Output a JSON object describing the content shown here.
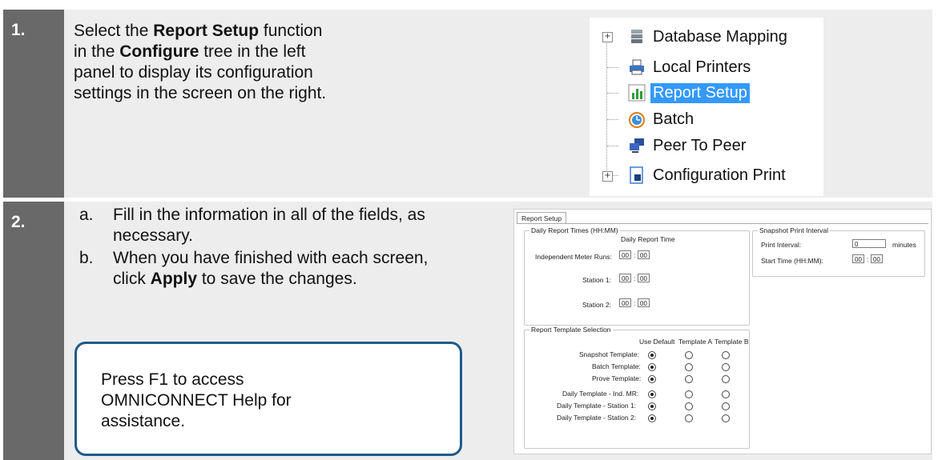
{
  "step1": {
    "number": "1.",
    "text_a": "Select the ",
    "text_b": "Report Setup",
    "text_c": " function in the ",
    "text_d": "Configure",
    "text_e": " tree in the left panel to display its configuration settings in the screen on the right.",
    "tree": [
      {
        "label": "Database Mapping",
        "icon": "database-icon",
        "expander": "+"
      },
      {
        "label": "Local Printers",
        "icon": "printer-icon"
      },
      {
        "label": "Report Setup",
        "icon": "report-chart-icon",
        "selected": true
      },
      {
        "label": "Batch",
        "icon": "clock-icon"
      },
      {
        "label": "Peer To Peer",
        "icon": "computers-icon"
      },
      {
        "label": "Configuration Print",
        "icon": "page-icon",
        "expander": "+"
      }
    ]
  },
  "step2": {
    "number": "2.",
    "item_a_marker": "a.",
    "item_a": "Fill in the information in all of the fields, as necessary.",
    "item_b_marker": "b.",
    "item_b_pre": "When you have finished with each screen, click ",
    "item_b_bold": "Apply",
    "item_b_post": " to save the changes.",
    "callout": "Press F1 to access OMNICONNECT Help for assistance."
  },
  "report_setup": {
    "tab": "Report Setup",
    "daily_group": "Daily Report Times (HH:MM)",
    "daily_col": "Daily Report Time",
    "rows": [
      {
        "label": "Independent Meter Runs:",
        "hh": "00",
        "mm": "00"
      },
      {
        "label": "Station 1:",
        "hh": "00",
        "mm": "00"
      },
      {
        "label": "Station 2:",
        "hh": "00",
        "mm": "00"
      }
    ],
    "colon": ":",
    "snapshot_group": "Snapshot Print Interval",
    "print_interval_label": "Print Interval:",
    "print_interval_value": "0",
    "minutes": "minutes",
    "start_time_label": "Start Time (HH:MM):",
    "start_hh": "00",
    "start_mm": "00",
    "template_group": "Report Template Selection",
    "template_cols": [
      "Use Default",
      "Template A",
      "Template B"
    ],
    "template_rows": [
      "Snapshot Template:",
      "Batch Template:",
      "Prove Template:",
      "Daily Template - Ind. MR:",
      "Daily Template - Station 1:",
      "Daily Template - Station 2:"
    ]
  }
}
